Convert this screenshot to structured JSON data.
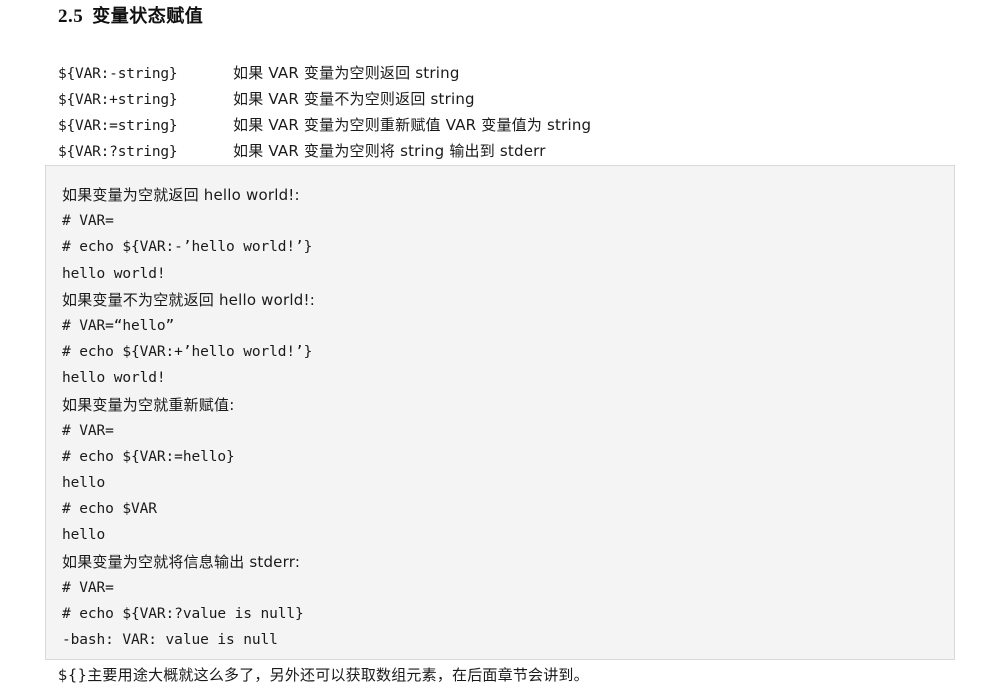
{
  "heading": {
    "number": "2.5",
    "title": "变量状态赋值"
  },
  "syntax_list": [
    {
      "expr": "${VAR:-string}",
      "desc": "如果 VAR 变量为空则返回 string"
    },
    {
      "expr": "${VAR:+string}",
      "desc": "如果 VAR 变量不为空则返回 string"
    },
    {
      "expr": "${VAR:=string}",
      "desc": "如果 VAR 变量为空则重新赋值 VAR 变量值为 string"
    },
    {
      "expr": "${VAR:?string}",
      "desc": "如果 VAR 变量为空则将 string 输出到 stderr"
    }
  ],
  "code_block": {
    "lines": [
      {
        "text": "如果变量为空就返回 hello world!:",
        "cn": true
      },
      {
        "text": "# VAR=",
        "cn": false
      },
      {
        "text": "# echo ${VAR:-’hello world!’}",
        "cn": false
      },
      {
        "text": "hello world!",
        "cn": false
      },
      {
        "text": "如果变量不为空就返回 hello world!:",
        "cn": true
      },
      {
        "text": "# VAR=“hello”",
        "cn": false
      },
      {
        "text": "# echo ${VAR:+’hello world!’}",
        "cn": false
      },
      {
        "text": "hello world!",
        "cn": false
      },
      {
        "text": "如果变量为空就重新赋值:",
        "cn": true
      },
      {
        "text": "# VAR=",
        "cn": false
      },
      {
        "text": "# echo ${VAR:=hello}",
        "cn": false
      },
      {
        "text": "hello",
        "cn": false
      },
      {
        "text": "# echo $VAR",
        "cn": false
      },
      {
        "text": "hello",
        "cn": false
      },
      {
        "text": "如果变量为空就将信息输出 stderr:",
        "cn": true
      },
      {
        "text": "# VAR=",
        "cn": false
      },
      {
        "text": "# echo ${VAR:?value is null}",
        "cn": false
      },
      {
        "text": "-bash: VAR: value is null",
        "cn": false
      }
    ]
  },
  "footer_note": "${}主要用途大概就这么多了，另外还可以获取数组元素，在后面章节会讲到。",
  "colors": {
    "code_background": "#f4f4f4",
    "code_border": "#d9d9d9",
    "text": "#1a1a1a",
    "page_background": "#ffffff"
  }
}
